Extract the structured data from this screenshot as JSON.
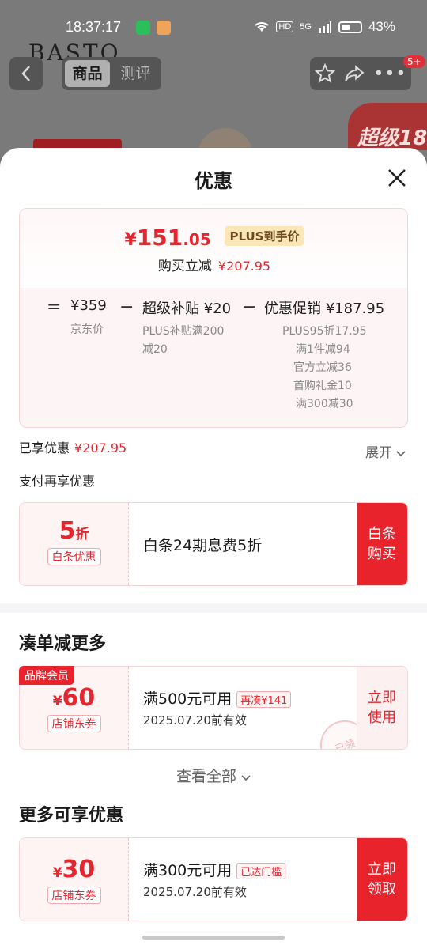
{
  "status_bar": {
    "time": "18:37:17",
    "network": "5G",
    "hd": "HD",
    "battery": "43%"
  },
  "background": {
    "brand_watermark": "BASTO",
    "tabs": [
      {
        "label": "商品",
        "active": true
      },
      {
        "label": "测评",
        "active": false
      }
    ],
    "message_badge": "5+",
    "promo_text": "超级18"
  },
  "sheet": {
    "title": "优惠",
    "final_price": {
      "yen": "¥",
      "integer": "151",
      "decimal": ".05"
    },
    "plus_tag": "PLUS到手价",
    "instant_cut_label": "购买立减",
    "instant_cut_value": "¥207.95",
    "calc": {
      "eq": "=",
      "minus": "−",
      "base_price": "¥359",
      "base_label": "京东价",
      "subsidy_main": "超级补贴 ¥20",
      "subsidy_detail_1": "PLUS补贴满200",
      "subsidy_detail_2": "减20",
      "promo_main": "优惠促销 ¥187.95",
      "promo_details": [
        "PLUS95折17.95",
        "满1件减94",
        "官方立减36",
        "首购礼金10",
        "满300减30"
      ]
    },
    "enjoyed_label": "已享优惠",
    "enjoyed_value": "¥207.95",
    "expand_label": "展开",
    "pay_more_label": "支付再享优惠",
    "baitiao": {
      "value": "5",
      "unit": "折",
      "label": "白条优惠",
      "title": "白条24期息费5折",
      "button_line1": "白条",
      "button_line2": "购买"
    },
    "section_combine_title": "凑单减更多",
    "brand_member_tag": "品牌会员",
    "coupon_60": {
      "yen": "¥",
      "value": "60",
      "label": "店铺东券",
      "title": "满500元可用",
      "condition": "再凑¥141",
      "expiry": "2025.07.20前有效",
      "button_line1": "立即",
      "button_line2": "使用",
      "stamp": "已领"
    },
    "see_all_label": "查看全部",
    "section_more_title": "更多可享优惠",
    "coupon_30": {
      "yen": "¥",
      "value": "30",
      "label": "店铺东券",
      "title": "满300元可用",
      "condition": "已达门槛",
      "expiry": "2025.07.20前有效",
      "button_line1": "立即",
      "button_line2": "领取"
    }
  },
  "colors": {
    "accent_red": "#e4262f",
    "button_red": "#e8232c",
    "plus_gold": "#fbe6b8"
  }
}
